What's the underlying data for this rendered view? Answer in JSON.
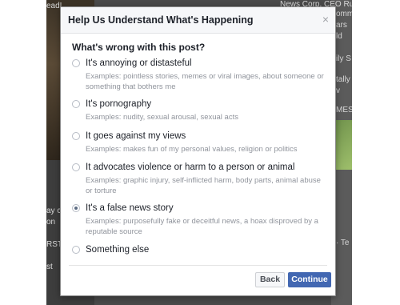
{
  "background": {
    "fragments": {
      "top_left": "ead!",
      "top_right": "News Corp. CEO Ru",
      "top_right_2": "omm",
      "right_1": "ars",
      "right_2": "ld",
      "right_3": "ily S",
      "right_4": "tally",
      "right_5": "v",
      "right_6": "MES",
      "big_letter": "e C",
      "left_1": "ay c",
      "left_2": "on",
      "left_3": "RST",
      "left_4": "st",
      "right_bottom": "· Te"
    }
  },
  "dialog": {
    "title": "Help Us Understand What's Happening",
    "close_glyph": "×",
    "question": "What's wrong with this post?",
    "options": [
      {
        "label": "It's annoying or distasteful",
        "example": "Examples: pointless stories, memes or viral images, about someone or something that bothers me",
        "checked": false
      },
      {
        "label": "It's pornography",
        "example": "Examples: nudity, sexual arousal, sexual acts",
        "checked": false
      },
      {
        "label": "It goes against my views",
        "example": "Examples: makes fun of my personal values, religion or politics",
        "checked": false
      },
      {
        "label": "It advocates violence or harm to a person or animal",
        "example": "Examples: graphic injury, self-inflicted harm, body parts, animal abuse or torture",
        "checked": false
      },
      {
        "label": "It's a false news story",
        "example": "Examples: purposefully fake or deceitful news, a hoax disproved by a reputable source",
        "checked": true
      },
      {
        "label": "Something else",
        "example": "",
        "checked": false
      }
    ],
    "back_label": "Back",
    "continue_label": "Continue"
  },
  "colors": {
    "primary_button": "#4267b2",
    "overlay": "#4a4a4a"
  }
}
